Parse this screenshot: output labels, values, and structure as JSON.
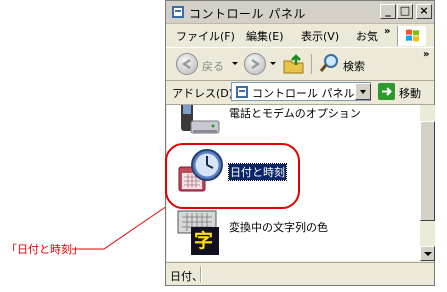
{
  "window": {
    "title": "コントロール パネル",
    "controls": {
      "minimize": "_",
      "maximize": "□",
      "close": "×"
    }
  },
  "menu": {
    "items": [
      "ファイル(F)",
      "編集(E)",
      "表示(V)",
      "お気"
    ],
    "more": "»"
  },
  "toolbar": {
    "back_label": "戻る",
    "search_label": "検索",
    "more": "»"
  },
  "address": {
    "label": "アドレス(D)",
    "value": "コントロール パネル",
    "go_label": "移動"
  },
  "items": [
    {
      "label": "電話とモデムのオプション",
      "icon": "phone-modem-icon"
    },
    {
      "label": "日付と時刻",
      "icon": "clock-calendar-icon",
      "selected": true
    },
    {
      "label": "変換中の文字列の色",
      "icon": "keyboard-ji-icon",
      "glyph": "字"
    }
  ],
  "status": {
    "text": "日付、"
  },
  "callout": {
    "label": "「日付と時刻」",
    "color": "#e60000"
  },
  "colors": {
    "selection": "#0a246a",
    "go_button": "#2e9a2e"
  }
}
